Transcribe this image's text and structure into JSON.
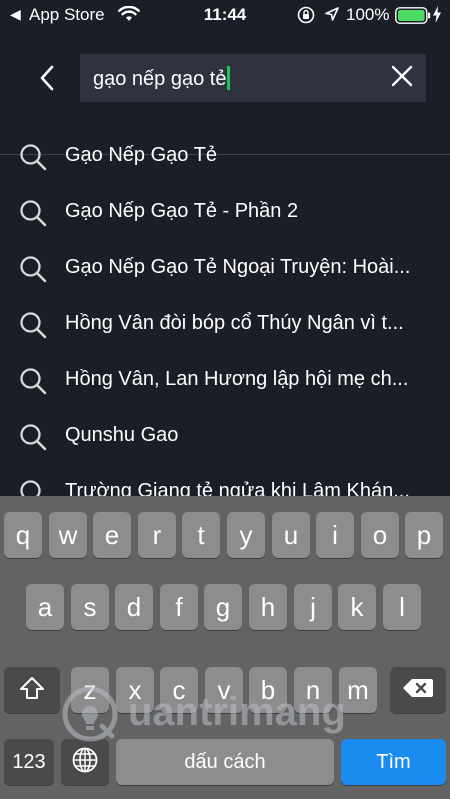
{
  "status_bar": {
    "back_arrow": "◀",
    "back_app": "App Store",
    "time": "11:44",
    "battery_percent": "100%",
    "icons": [
      "wifi-icon",
      "orientation-lock-icon",
      "location-icon",
      "battery-icon",
      "charging-icon"
    ],
    "battery_level": 1.0
  },
  "search": {
    "query": "gạo nếp gạo tẻ",
    "icons": [
      "back-chevron-icon",
      "clear-x-icon"
    ],
    "caret_color": "#21c45a"
  },
  "suggestions": [
    {
      "label": "Gạo Nếp Gạo Tẻ"
    },
    {
      "label": "Gạo Nếp Gạo Tẻ - Phần 2"
    },
    {
      "label": "Gạo Nếp Gạo Tẻ Ngoại Truyện: Hoài..."
    },
    {
      "label": "Hồng Vân đòi bóp cổ Thúy Ngân vì t..."
    },
    {
      "label": "Hồng Vân, Lan Hương lập hội mẹ ch..."
    },
    {
      "label": "Qunshu Gao"
    },
    {
      "label": "Trường Giang tẻ ngửa khi Lâm Khán..."
    }
  ],
  "keyboard": {
    "row1": [
      "q",
      "w",
      "e",
      "r",
      "t",
      "y",
      "u",
      "i",
      "o",
      "p"
    ],
    "row2": [
      "a",
      "s",
      "d",
      "f",
      "g",
      "h",
      "j",
      "k",
      "l"
    ],
    "row3": [
      "z",
      "x",
      "c",
      "v",
      "b",
      "n",
      "m"
    ],
    "numbers_key": "123",
    "space_key": "dấu cách",
    "return_key": "Tìm",
    "icons": [
      "shift-icon",
      "backspace-icon",
      "globe-icon"
    ],
    "return_color": "#1a8cf0"
  },
  "watermark": {
    "text": "uantrimang"
  }
}
